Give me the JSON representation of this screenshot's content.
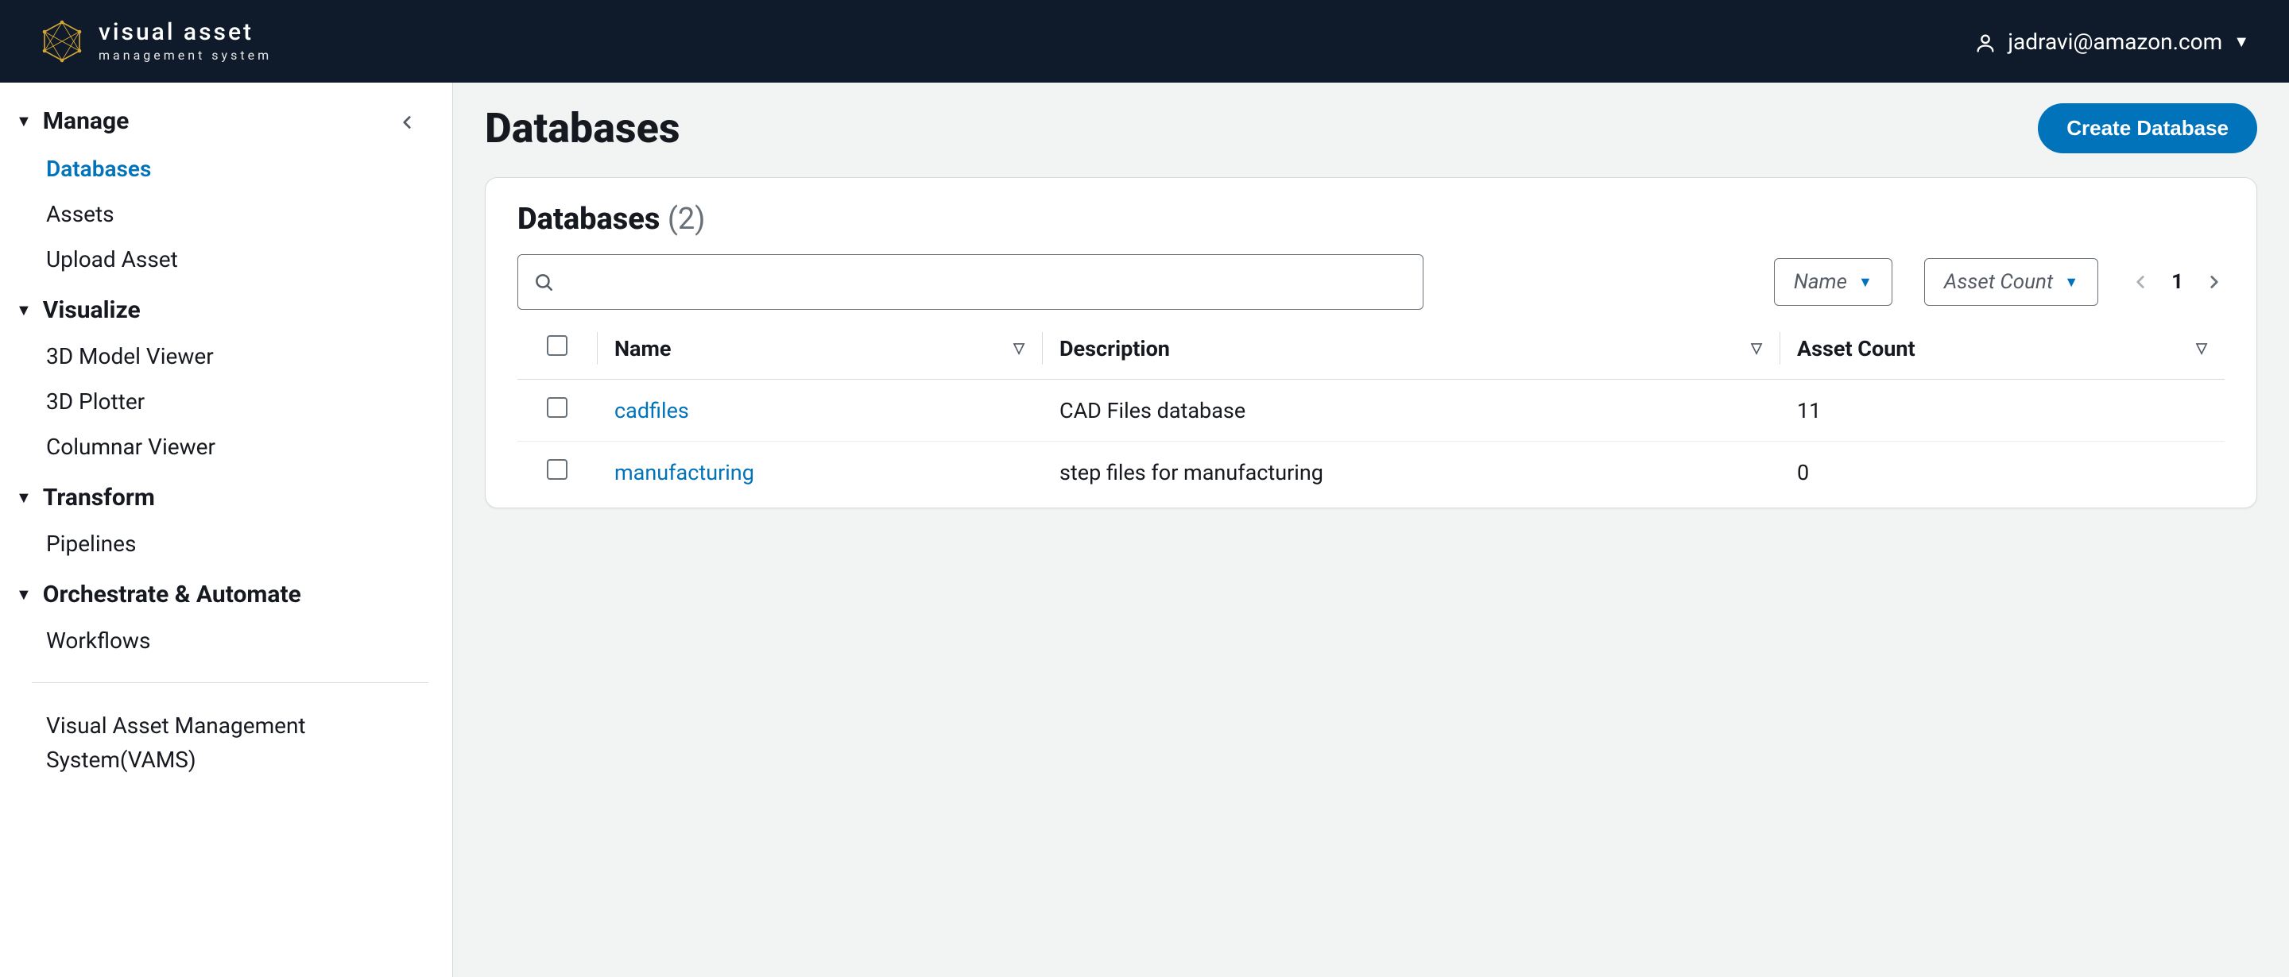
{
  "brand": {
    "title": "visual asset",
    "subtitle": "management system"
  },
  "user": {
    "email": "jadravi@amazon.com"
  },
  "sidebar": {
    "groups": [
      {
        "title": "Manage",
        "items": [
          {
            "label": "Databases",
            "active": true
          },
          {
            "label": "Assets",
            "active": false
          },
          {
            "label": "Upload Asset",
            "active": false
          }
        ]
      },
      {
        "title": "Visualize",
        "items": [
          {
            "label": "3D Model Viewer"
          },
          {
            "label": "3D Plotter"
          },
          {
            "label": "Columnar Viewer"
          }
        ]
      },
      {
        "title": "Transform",
        "items": [
          {
            "label": "Pipelines"
          }
        ]
      },
      {
        "title": "Orchestrate & Automate",
        "items": [
          {
            "label": "Workflows"
          }
        ]
      }
    ],
    "footer": "Visual Asset Management System(VAMS)"
  },
  "page": {
    "title": "Databases",
    "actions": {
      "create_label": "Create Database"
    }
  },
  "panel": {
    "title": "Databases",
    "count_display": "(2)",
    "filters": {
      "name_label": "Name",
      "count_label": "Asset Count"
    },
    "search_placeholder": "",
    "pager": {
      "page": "1"
    },
    "columns": {
      "name": "Name",
      "description": "Description",
      "asset_count": "Asset Count"
    },
    "rows": [
      {
        "name": "cadfiles",
        "description": "CAD Files database",
        "asset_count": "11"
      },
      {
        "name": "manufacturing",
        "description": "step files for manufacturing",
        "asset_count": "0"
      }
    ]
  }
}
